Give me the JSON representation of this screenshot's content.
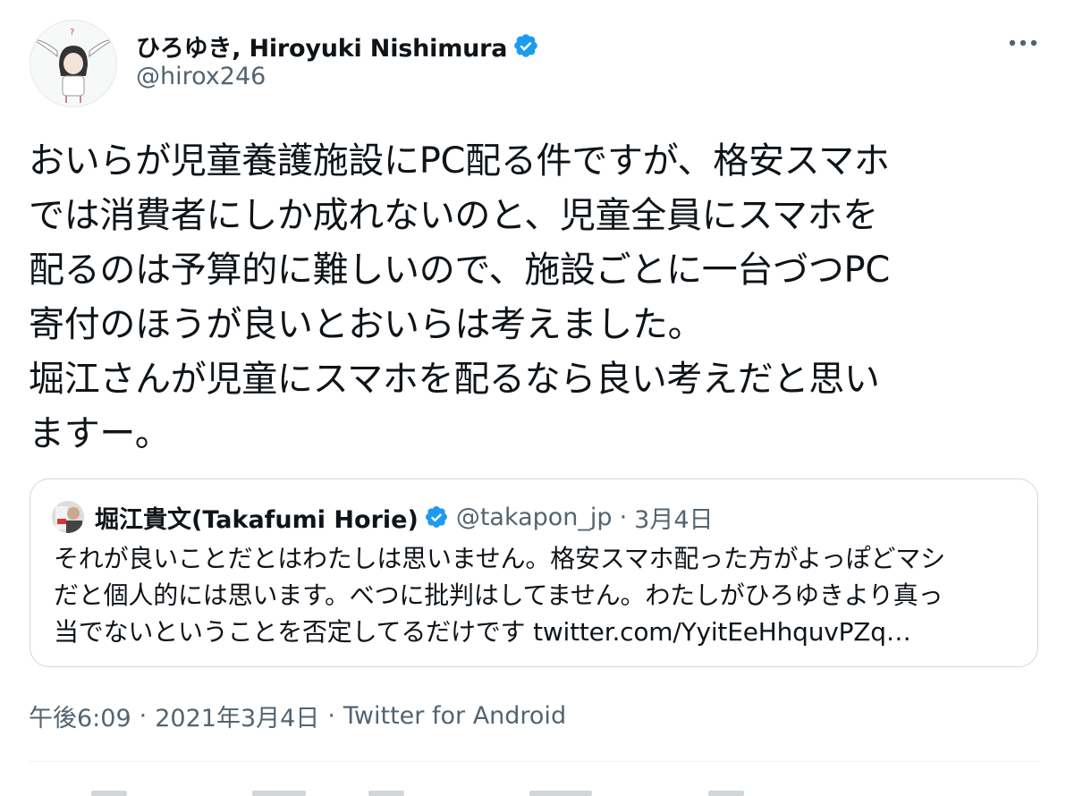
{
  "author": {
    "display_name": "ひろゆき, Hiroyuki Nishimura",
    "handle": "@hirox246",
    "verified": true
  },
  "tweet": {
    "lines": [
      "おいらが児童養護施設にPC配る件ですが、格安スマホ",
      "では消費者にしか成れないのと、児童全員にスマホを",
      "配るのは予算的に難しいので、施設ごとに一台づつPC",
      "寄付のほうが良いとおいらは考えました。",
      "堀江さんが児童にスマホを配るなら良い考えだと思い",
      "ますー。"
    ]
  },
  "quoted_tweet": {
    "display_name": "堀江貴文(Takafumi Horie)",
    "handle": "@takapon_jp",
    "separator": "·",
    "date": "3月4日",
    "verified": true,
    "lines": [
      "それが良いことだとはわたしは思いません。格安スマホ配った方がよっぽどマシ",
      "だと個人的には思います。べつに批判はしてません。わたしがひろゆきより真っ",
      "当でないということを否定してるだけです twitter.com/YyitEeHhquvPZq…"
    ]
  },
  "meta": {
    "time": "午後6:09",
    "separator": "·",
    "date": "2021年3月4日",
    "source": "Twitter for Android"
  },
  "icons": {
    "more": "more-horizontal-icon",
    "verified": "verified-badge-icon"
  },
  "colors": {
    "verified_blue": "#1d9bf0",
    "secondary_text": "#536471",
    "border": "#cfd9de",
    "text": "#0f1419"
  }
}
